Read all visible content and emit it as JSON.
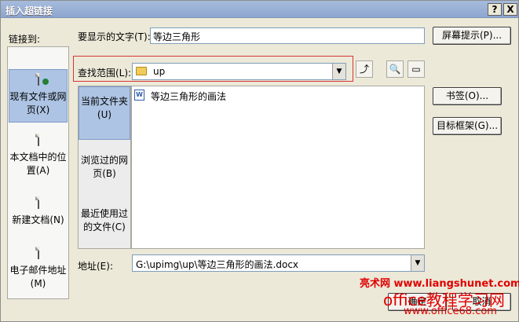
{
  "window": {
    "title": "插入超链接",
    "help_label": "?",
    "close_label": "X"
  },
  "link_to": {
    "label": "链接到:",
    "items": [
      {
        "label": "现有文件或网页(X)",
        "icon": "existing-file-web-icon",
        "selected": true
      },
      {
        "label": "本文档中的位置(A)",
        "icon": "place-in-document-icon",
        "selected": false
      },
      {
        "label": "新建文档(N)",
        "icon": "new-document-icon",
        "selected": false
      },
      {
        "label": "电子邮件地址(M)",
        "icon": "email-address-icon",
        "selected": false
      }
    ]
  },
  "display_text": {
    "label": "要显示的文字(T):",
    "value": "等边三角形"
  },
  "screentip_button": "屏幕提示(P)...",
  "look_in": {
    "label": "查找范围(L):",
    "value": "up"
  },
  "inner_places": [
    {
      "label": "当前文件夹(U)",
      "selected": true
    },
    {
      "label": "浏览过的网页(B)",
      "selected": false
    },
    {
      "label": "最近使用过的文件(C)",
      "selected": false
    }
  ],
  "files": [
    {
      "name": "等边三角形的画法",
      "icon": "word-document-icon",
      "icon_letter": "W"
    }
  ],
  "bookmark_button": "书签(O)...",
  "target_frame_button": "目标框架(G)...",
  "address": {
    "label": "地址(E):",
    "value": "G:\\upimg\\up\\等边三角形的画法.docx"
  },
  "ok_button": "确定",
  "cancel_button": "取消",
  "watermark": {
    "line1": "亮术网 www.liangshunet.com",
    "line2": "office教程学习网",
    "line3": "www.office68.com"
  },
  "colors": {
    "selection": "#aec4e4",
    "highlight_border": "#d83434",
    "watermark": "#e00000"
  }
}
